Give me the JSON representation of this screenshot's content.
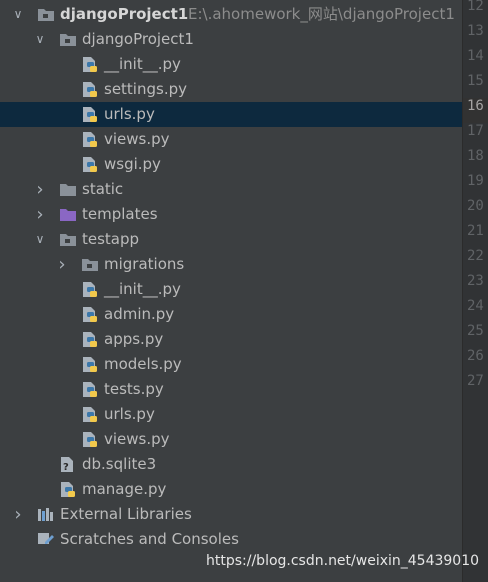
{
  "project": {
    "root_name": "djangoProject1",
    "root_path": "E:\\.ahomework_网站\\djangoProject1"
  },
  "tree": [
    {
      "label": "djangoProject1",
      "depth": 0,
      "kind": "root-folder",
      "expanded": true
    },
    {
      "label": "djangoProject1",
      "depth": 1,
      "kind": "module-folder",
      "expanded": true
    },
    {
      "label": "__init__.py",
      "depth": 2,
      "kind": "python-file"
    },
    {
      "label": "settings.py",
      "depth": 2,
      "kind": "python-file"
    },
    {
      "label": "urls.py",
      "depth": 2,
      "kind": "python-file",
      "selected": true
    },
    {
      "label": "views.py",
      "depth": 2,
      "kind": "python-file"
    },
    {
      "label": "wsgi.py",
      "depth": 2,
      "kind": "python-file"
    },
    {
      "label": "static",
      "depth": 1,
      "kind": "folder",
      "expanded": false
    },
    {
      "label": "templates",
      "depth": 1,
      "kind": "templates-folder",
      "expanded": false
    },
    {
      "label": "testapp",
      "depth": 1,
      "kind": "module-folder",
      "expanded": true
    },
    {
      "label": "migrations",
      "depth": 2,
      "kind": "module-folder",
      "expanded": false
    },
    {
      "label": "__init__.py",
      "depth": 2,
      "kind": "python-file"
    },
    {
      "label": "admin.py",
      "depth": 2,
      "kind": "python-file"
    },
    {
      "label": "apps.py",
      "depth": 2,
      "kind": "python-file"
    },
    {
      "label": "models.py",
      "depth": 2,
      "kind": "python-file"
    },
    {
      "label": "tests.py",
      "depth": 2,
      "kind": "python-file"
    },
    {
      "label": "urls.py",
      "depth": 2,
      "kind": "python-file"
    },
    {
      "label": "views.py",
      "depth": 2,
      "kind": "python-file"
    },
    {
      "label": "db.sqlite3",
      "depth": 1,
      "kind": "unknown-file"
    },
    {
      "label": "manage.py",
      "depth": 1,
      "kind": "python-file"
    },
    {
      "label": "External Libraries",
      "depth": 0,
      "kind": "libraries",
      "expanded": false
    },
    {
      "label": "Scratches and Consoles",
      "depth": 0,
      "kind": "scratches"
    }
  ],
  "gutter": {
    "line_numbers": [
      "12",
      "13",
      "14",
      "15",
      "16",
      "17",
      "18",
      "19",
      "20",
      "21",
      "22",
      "23",
      "24",
      "25",
      "26",
      "27"
    ],
    "current_line": "16"
  },
  "watermark": "https://blog.csdn.net/weixin_45439010",
  "colors": {
    "panel_bg": "#3c3f41",
    "selection_bg": "#0d293e",
    "text": "#bbbbbb",
    "muted_path": "#8c8c8c",
    "folder_icon": "#8a9199",
    "templates_folder_icon": "#8a67c4",
    "python_blue": "#3c78aa",
    "python_yellow": "#f2c94c"
  }
}
